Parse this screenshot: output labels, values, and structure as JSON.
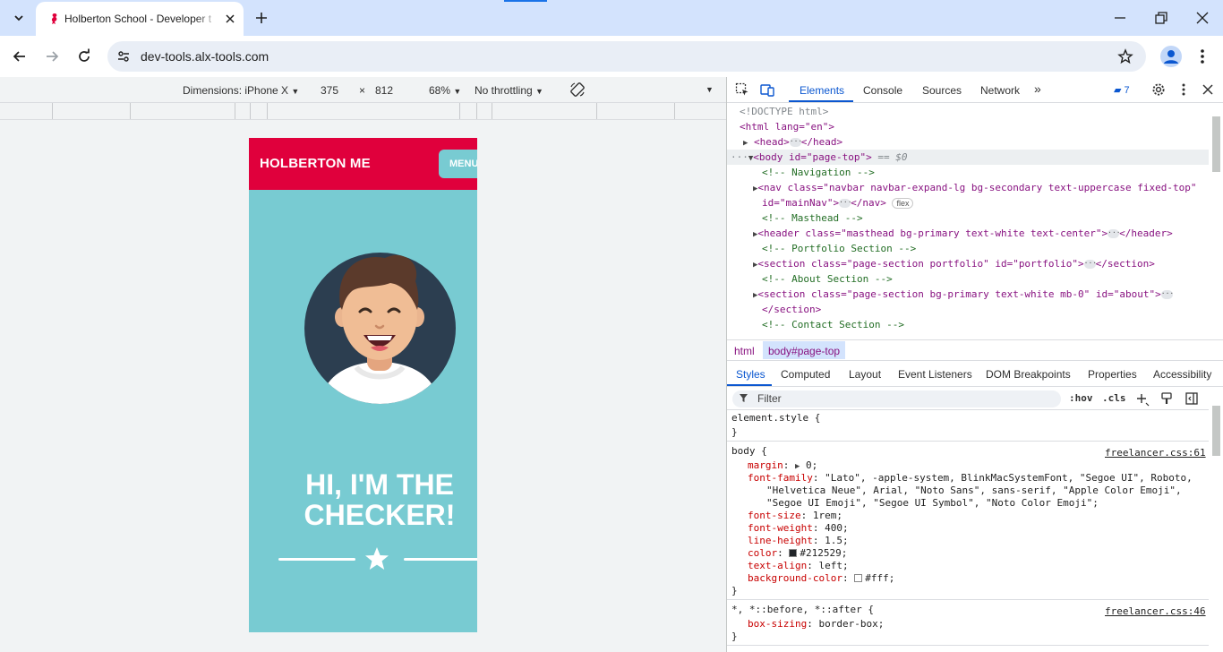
{
  "browser": {
    "tab_title": "Holberton School - Developer t",
    "url": "dev-tools.alx-tools.com"
  },
  "device_toolbar": {
    "dimensions_label": "Dimensions: iPhone X",
    "width": "375",
    "times": "×",
    "height": "812",
    "zoom": "68%",
    "throttling": "No throttling"
  },
  "page": {
    "brand": "HOLBERTON ME",
    "menu_label": "MENU",
    "hero_line1": "HI, I'M THE",
    "hero_line2": "CHECKER!"
  },
  "devtools": {
    "tabs": [
      "Elements",
      "Console",
      "Sources",
      "Network"
    ],
    "messages_count": "7",
    "dom": {
      "doctype": "<!DOCTYPE html>",
      "html_open": "<html lang=\"en\">",
      "head": "<head>",
      "head_close": "</head>",
      "body_open": "<body id=\"page-top\">",
      "selected_marker": "== $0",
      "c_nav": "<!-- Navigation -->",
      "nav_line1": "<nav class=\"navbar navbar-expand-lg bg-secondary text-uppercase fixed-top\"",
      "nav_line2": "id=\"mainNav\">",
      "nav_close": "</nav>",
      "flex_badge": "flex",
      "c_masthead": "<!-- Masthead -->",
      "header_line": "<header class=\"masthead bg-primary text-white text-center\">",
      "header_close": "</header>",
      "c_portfolio": "<!-- Portfolio Section -->",
      "section1": "<section class=\"page-section portfolio\" id=\"portfolio\">",
      "section_close": "</section>",
      "c_about": "<!-- About Section -->",
      "section2": "<section class=\"page-section bg-primary text-white mb-0\" id=\"about\">",
      "section2_close": "</section>",
      "c_contact": "<!-- Contact Section -->"
    },
    "breadcrumbs": [
      "html",
      "body#page-top"
    ],
    "style_tabs": [
      "Styles",
      "Computed",
      "Layout",
      "Event Listeners",
      "DOM Breakpoints",
      "Properties",
      "Accessibility"
    ],
    "filter_placeholder": "Filter",
    "filter_tools": [
      ":hov",
      ".cls"
    ],
    "styles": {
      "element_style": "element.style {",
      "close_brace": "}",
      "body_selector": "body {",
      "body_source": "freelancer.css:61",
      "margin_prop": "margin",
      "margin_val": "0;",
      "ff_prop": "font-family",
      "ff_val1": "\"Lato\", -apple-system, BlinkMacSystemFont, \"Segoe UI\", Roboto,",
      "ff_val2": "\"Helvetica Neue\", Arial, \"Noto Sans\", sans-serif, \"Apple Color Emoji\",",
      "ff_val3": "\"Segoe UI Emoji\", \"Segoe UI Symbol\", \"Noto Color Emoji\";",
      "fs_prop": "font-size",
      "fs_val": "1rem;",
      "fw_prop": "font-weight",
      "fw_val": "400;",
      "lh_prop": "line-height",
      "lh_val": "1.5;",
      "color_prop": "color",
      "color_val": "#212529;",
      "ta_prop": "text-align",
      "ta_val": "left;",
      "bg_prop": "background-color",
      "bg_val": "#fff;",
      "universal_selector": "*, *::before, *::after {",
      "universal_source": "freelancer.css:46",
      "bs_prop": "box-sizing",
      "bs_val": "border-box;"
    }
  },
  "colors": {
    "brand_red": "#e0003c",
    "teal": "#78cbd2",
    "avatar_bg": "#2c3e50",
    "devtools_accent": "#0b57d0"
  }
}
